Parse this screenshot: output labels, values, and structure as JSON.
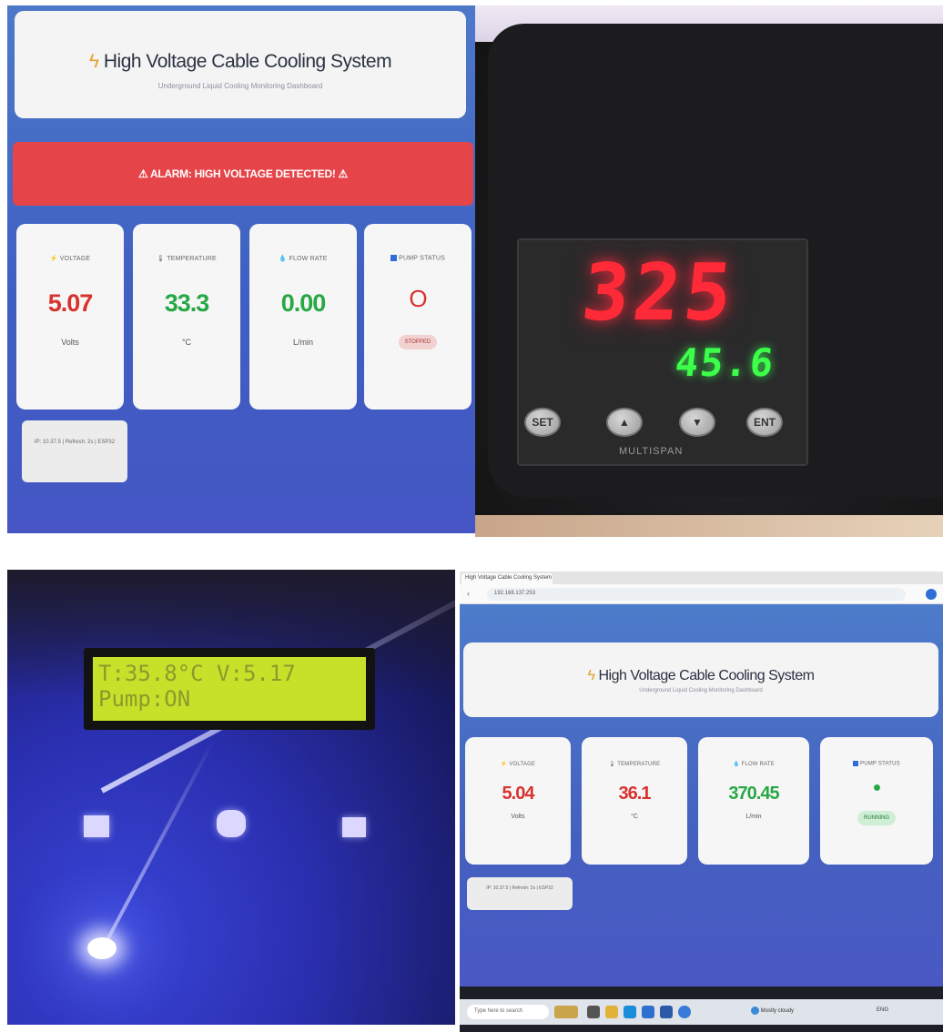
{
  "dashboard_photo": {
    "title": "High Voltage Cable Cooling System",
    "subtitle": "Underground Liquid Cooling Monitoring Dashboard",
    "alarm": "⚠ ALARM: HIGH VOLTAGE DETECTED! ⚠",
    "metrics": [
      {
        "label": "⚡ VOLTAGE",
        "value": "5.07",
        "unit": "Volts",
        "color": "#d8322f"
      },
      {
        "label": "🌡 TEMPERATURE",
        "value": "33.3",
        "unit": "°C",
        "color": "#27a844"
      },
      {
        "label": "💧 FLOW RATE",
        "value": "0.00",
        "unit": "L/min",
        "color": "#27a844"
      }
    ],
    "pump": {
      "label": "PUMP STATUS",
      "indicator": "O",
      "badge": "STOPPED"
    },
    "footer": "IP: 10.37.5 | Refresh: 2s | ESP32"
  },
  "controller_photo": {
    "pv": "325",
    "sv": "45.6",
    "buttons": [
      "SET",
      "▲",
      "▼",
      "ENT"
    ],
    "brand": "MULTISPAN"
  },
  "lcd_photo": {
    "line1": "T:35.8°C V:5.17",
    "line2": "Pump:ON"
  },
  "browser_screenshot": {
    "tab_title": "High Voltage Cable Cooling System",
    "url": "192.168.137.253",
    "title": "High Voltage Cable Cooling System",
    "subtitle": "Underground Liquid Cooling Monitoring Dashboard",
    "metrics": [
      {
        "label": "⚡ VOLTAGE",
        "value": "5.04",
        "unit": "Volts",
        "color": "#d8322f"
      },
      {
        "label": "🌡 TEMPERATURE",
        "value": "36.1",
        "unit": "°C",
        "color": "#d8322f"
      },
      {
        "label": "💧 FLOW RATE",
        "value": "370.45",
        "unit": "L/min",
        "color": "#27a844"
      }
    ],
    "pump": {
      "label": "PUMP STATUS",
      "indicator": "●",
      "badge": "RUNNING"
    },
    "footer": "IP: 10.37.5 | Refresh: 2s | ESP32",
    "taskbar_search": "Type here to search",
    "weather": "Mostly cloudy",
    "lang": "ENG"
  }
}
